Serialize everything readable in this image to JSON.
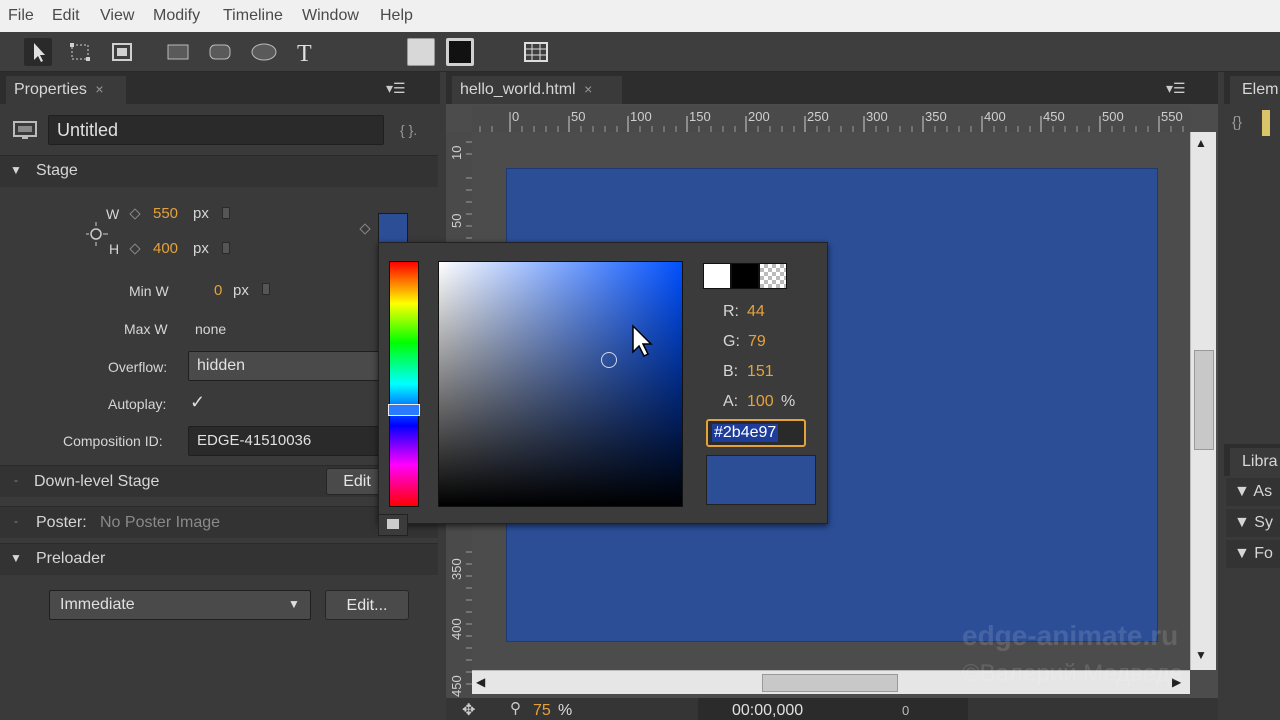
{
  "menu": [
    "File",
    "Edit",
    "View",
    "Modify",
    "Timeline",
    "Window",
    "Help"
  ],
  "properties": {
    "tab_label": "Properties",
    "composition_name": "Untitled",
    "stage_header": "Stage",
    "w_label": "W",
    "w_value": "550",
    "h_label": "H",
    "h_value": "400",
    "px": "px",
    "min_w_label": "Min W",
    "min_w_value": "0",
    "max_w_label": "Max W",
    "max_w_value": "none",
    "overflow_label": "Overflow:",
    "overflow_value": "hidden",
    "autoplay_label": "Autoplay:",
    "autoplay_check": "✓",
    "composition_id_label": "Composition ID:",
    "composition_id_value": "EDGE-41510036",
    "downlevel_label": "Down-level Stage",
    "edit_label": "Edit",
    "poster_label": "Poster:",
    "poster_value": "No Poster Image",
    "preloader_header": "Preloader",
    "preloader_value": "Immediate",
    "preloader_edit": "Edit..."
  },
  "document": {
    "tab_label": "hello_world.html",
    "ruler_top": [
      "0",
      "50",
      "100",
      "150",
      "200",
      "250",
      "300",
      "350",
      "400",
      "450",
      "500",
      "550"
    ],
    "ruler_left": [
      "10",
      "50",
      "350",
      "400",
      "450"
    ],
    "zoom_value": "75",
    "zoom_unit": "%",
    "timecode": "00:00,000",
    "time_zero": "0"
  },
  "picker": {
    "r_label": "R:",
    "r_value": "44",
    "g_label": "G:",
    "g_value": "79",
    "b_label": "B:",
    "b_value": "151",
    "a_label": "A:",
    "a_value": "100",
    "a_unit": "%",
    "hex_value": "#2b4e97"
  },
  "right_panels": {
    "elements_tab": "Elem",
    "library_tab": "Libra",
    "items": [
      "As",
      "Sy",
      "Fo"
    ]
  },
  "watermark": {
    "line1": "edge-animate.ru",
    "line2": "©Валерий Медведе"
  },
  "colors": {
    "stage": "#2b4e97",
    "accent_value": "#e6a23a"
  }
}
